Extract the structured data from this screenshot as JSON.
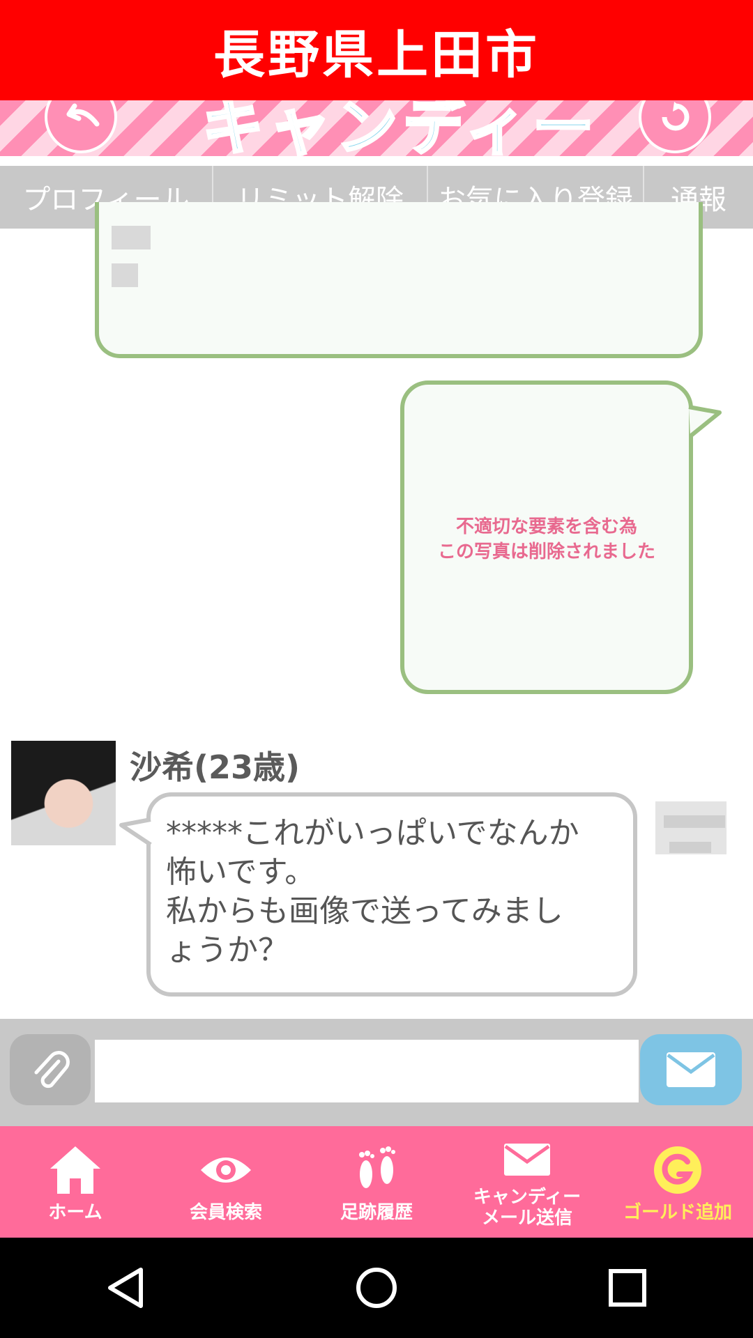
{
  "header": {
    "city_title": "長野県上田市"
  },
  "tabs": [
    {
      "label": "プロフィール"
    },
    {
      "label": "リミット解除"
    },
    {
      "label": "お気に入り登録"
    },
    {
      "label": "通報"
    }
  ],
  "chat": {
    "deleted_photo_notice": [
      "不適切な要素を含む為",
      "この写真は削除されました"
    ],
    "partner_name": "沙希(23歳)",
    "partner_message": "*****これがいっぱいでなんか\n怖いです。\n私からも画像で送ってみまし\nょうか？"
  },
  "input": {
    "placeholder": ""
  },
  "bottom_nav": [
    {
      "label": "ホーム",
      "icon": "home-icon"
    },
    {
      "label": "会員検索",
      "icon": "eye-icon"
    },
    {
      "label": "足跡履歴",
      "icon": "footprints-icon"
    },
    {
      "label": "キャンディー\nメール送信",
      "icon": "mail-icon"
    },
    {
      "label": "ゴールド追加",
      "icon": "gold-g-icon"
    }
  ],
  "colors": {
    "top_banner": "#ff0000",
    "nav_background": "#ff6b9a",
    "gold": "#ffef5a",
    "bubble_border_green": "#9abf80",
    "deleted_text": "#e8698f",
    "send_button": "#7ec4e4"
  }
}
